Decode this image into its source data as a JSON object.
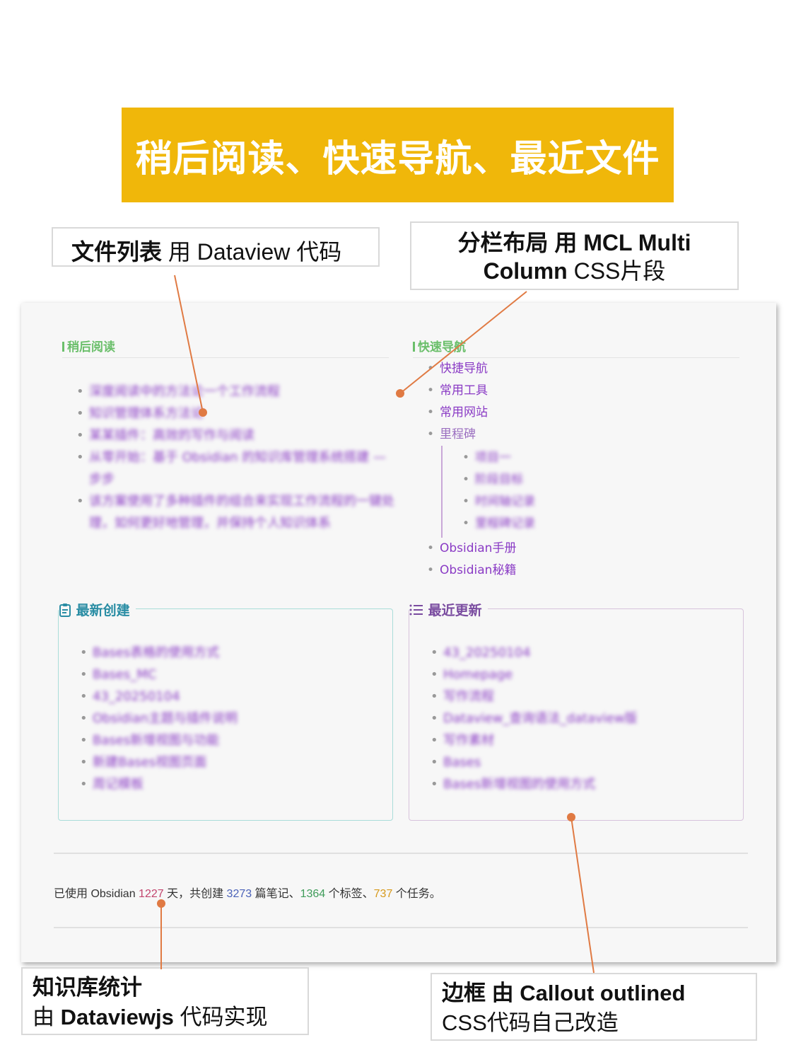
{
  "banner": {
    "title": "稍后阅读、快速导航、最近文件",
    "color": "#f0b70a"
  },
  "annotations": {
    "file_list": {
      "bold": "文件列表",
      "rest": " 用 Dataview 代码"
    },
    "column_layout": {
      "line1_bold": "分栏布局",
      "line1_rest": " 用 MCL Multi",
      "line2_bold": "Column",
      "line2_rest": "  CSS片段"
    },
    "stats": {
      "line1": "知识库统计",
      "line2_prefix": "由 ",
      "line2_bold": "Dataviewjs",
      "line2_rest": " 代码实现"
    },
    "border": {
      "line1_bold": "边框",
      "line1_rest": " 由 Callout outlined",
      "line2": "CSS代码自己改造"
    }
  },
  "read_later": {
    "heading": "稍后阅读",
    "items": [
      "深度阅读中的方法论一个工作流程",
      "知识管理体系方法论",
      "某某插件：高效的写作与阅读",
      "从零开始：基于 Obsidian 的知识库管理系统搭建 —步步",
      "该方案使用了多种插件的组合来实现工作流程的一键处理，如何更好地管理，并保持个人知识体系"
    ]
  },
  "quick_nav": {
    "heading": "快速导航",
    "items": [
      "快捷导航",
      "常用工具",
      "常用网站"
    ],
    "milestone": "里程碑",
    "milestone_items": [
      "项目一",
      "阶段目标",
      "时间轴记录",
      "里程碑记录"
    ],
    "tail_items": [
      "Obsidian手册",
      "Obsidian秘籍"
    ]
  },
  "recent_created": {
    "title": "最新创建",
    "icon": "clipboard-icon",
    "items": [
      "Bases表格的使用方式",
      "Bases_MC",
      "43_20250104",
      "Obsidian主题与插件说明",
      "Bases新增视图与功能",
      "新建Bases视图页面",
      "周记模板"
    ]
  },
  "recent_updated": {
    "title": "最近更新",
    "icon": "list-icon",
    "items": [
      "43_20250104",
      "Homepage",
      "写作流程",
      "Dataview_查询语法_dataview版",
      "写作素材",
      "Bases",
      "Bases新增视图的使用方式"
    ]
  },
  "stats": {
    "prefix": "已使用 Obsidian ",
    "days": "1227",
    "days_suffix": " 天，共创建 ",
    "notes": "3273",
    "notes_suffix": " 篇笔记、",
    "tags": "1364",
    "tags_suffix": " 个标签、",
    "tasks": "737",
    "tasks_suffix": " 个任务。"
  }
}
